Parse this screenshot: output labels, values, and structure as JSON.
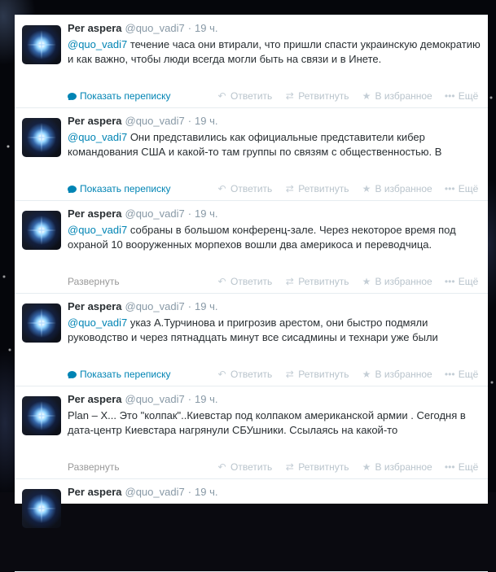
{
  "user": {
    "name": "Per aspera",
    "handle": "@quo_vadi7",
    "separator": "·"
  },
  "actions": {
    "reply": "Ответить",
    "retweet": "Ретвитнуть",
    "favorite": "В избранное",
    "more": "Ещё",
    "icons": [
      "reply-icon",
      "retweet-icon",
      "favorite-star-icon",
      "more-dots-icon"
    ]
  },
  "colors": {
    "link": "#0084b4",
    "muted": "#8899a6",
    "text": "#292f33"
  },
  "tweets": [
    {
      "time": "19 ч.",
      "mention": "@quo_vadi7",
      "text": " течение часа они втирали, что пришли спасти украинскую демократию и как важно, чтобы люди всегда могли быть на связи и в Инете.",
      "expand_label": "Показать переписку",
      "expand_type": "conversation"
    },
    {
      "time": "19 ч.",
      "mention": "@quo_vadi7",
      "text": "  Они представились как официальные представители кибер командования США и какой-то там группы по связям с общественностью. В",
      "expand_label": "Показать переписку",
      "expand_type": "conversation"
    },
    {
      "time": "19 ч.",
      "mention": "@quo_vadi7",
      "text": " собраны в большом конференц-зале.  Через некоторое время под охраной 10 вооруженных морпехов вошли два америкоса и переводчица.",
      "expand_label": "Развернуть",
      "expand_type": "expand"
    },
    {
      "time": "19 ч.",
      "mention": "@quo_vadi7",
      "text": "  указ А.Турчинова и пригрозив арестом, они быстро подмяли руководство и через пятнадцать минут все сисадмины и технари уже были",
      "expand_label": "Показать переписку",
      "expand_type": "conversation"
    },
    {
      "time": "19 ч.",
      "mention": "",
      "text": "Plan – X... Это \"колпак\"..Киевстар под колпаком американской армии . Сегодня в дата-центр Киевстара нагрянули СБУшники. Ссылаясь на какой-то",
      "expand_label": "Развернуть",
      "expand_type": "expand"
    },
    {
      "time": "19 ч.",
      "mention": "",
      "text": "",
      "expand_label": "",
      "expand_type": "none"
    }
  ]
}
